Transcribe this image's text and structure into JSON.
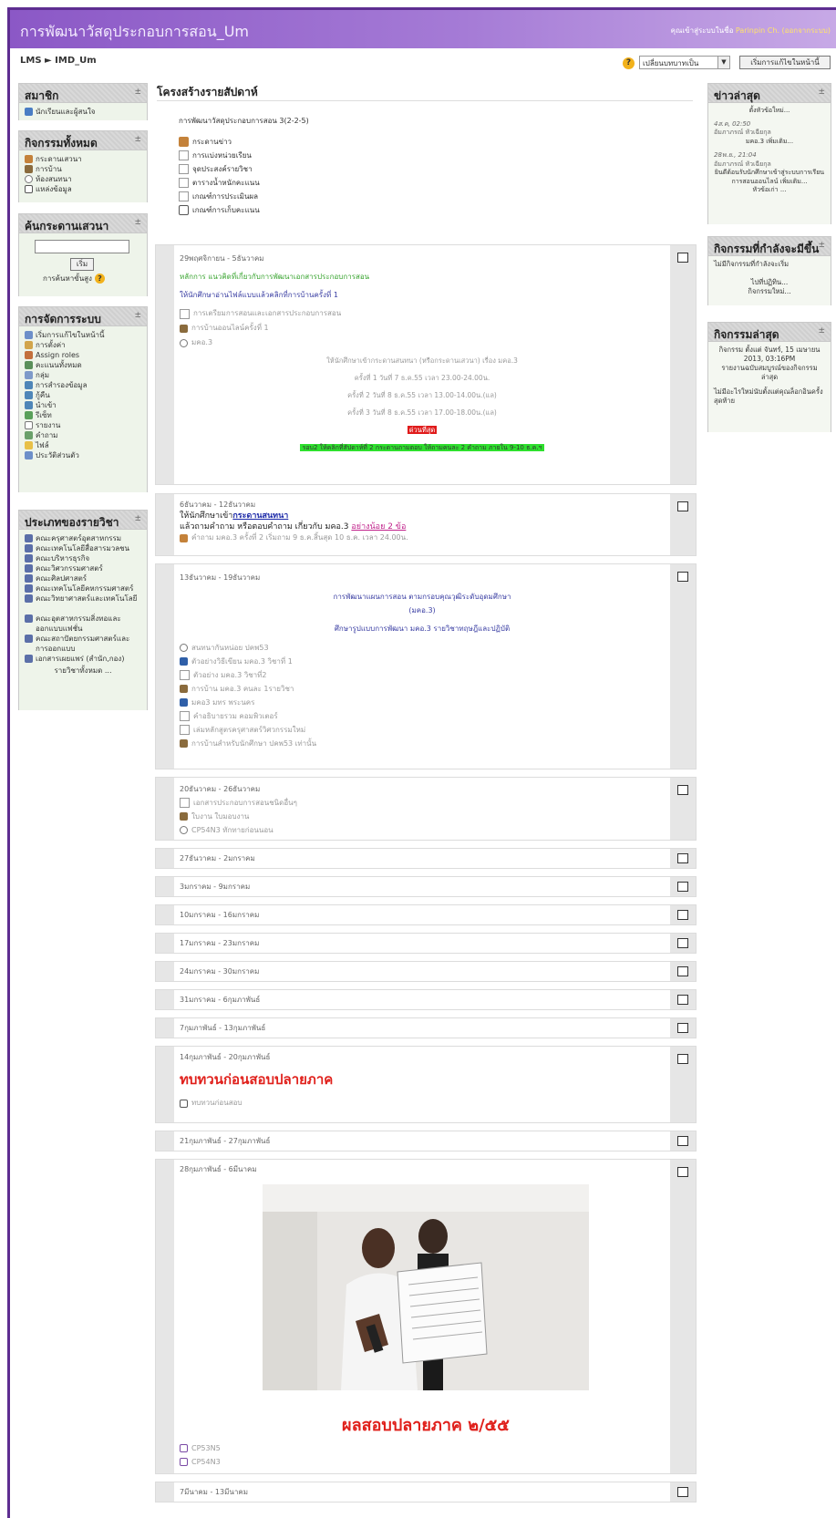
{
  "header": {
    "site_title": "การพัฒนาวัสดุประกอบการสอน_Um",
    "login_prefix": "คุณเข้าสู่ระบบในชื่อ",
    "user_name": "Parinpin Ch.",
    "logout_text": "(ออกจากระบบ)"
  },
  "nav": {
    "breadcrumb": "LMS ► IMD_Um",
    "role_select": "เปลี่ยนบทบาทเป็น",
    "edit_button": "เริ่มการแก้ไขในหน้านี้"
  },
  "left": {
    "members": {
      "title": "สมาชิก",
      "items": [
        "นักเรียนและผู้สนใจ"
      ]
    },
    "activities": {
      "title": "กิจกรรมทั้งหมด",
      "items": [
        "กระดานเสวนา",
        "การบ้าน",
        "ห้องสนทนา",
        "แหล่งข้อมูล"
      ]
    },
    "search": {
      "title": "ค้นกระดานเสวนา",
      "button": "เริ่ม",
      "advanced": "การค้นหาขั้นสูง"
    },
    "admin": {
      "title": "การจัดการระบบ",
      "items": [
        "เริ่มการแก้ไขในหน้านี้",
        "การตั้งค่า",
        "Assign roles",
        "คะแนนทั้งหมด",
        "กลุ่ม",
        "การสำรองข้อมูล",
        "กู้คืน",
        "นำเข้า",
        "รีเซ็ท",
        "รายงาน",
        "คำถาม",
        "ไฟล์",
        "ประวัติส่วนตัว"
      ]
    },
    "categories": {
      "title": "ประเภทของรายวิชา",
      "items": [
        "คณะครุศาสตร์อุตสาหกรรม",
        "คณะเทคโนโลยีสื่อสารมวลชน",
        "คณะบริหารธุรกิจ",
        "คณะวิศวกรรมศาสตร์",
        "คณะศิลปศาสตร์",
        "คณะเทคโนโลยีคหกรรมศาสตร์",
        "คณะวิทยาศาสตร์และเทคโนโลยี",
        "คณะอุตสาหกรรมสิ่งทอและออกแบบแฟชั่น",
        "คณะสถาปัตยกรรมศาสตร์และการออกแบบ",
        "เอกสารเผยแพร่ (สำนัก,กอง)"
      ],
      "all": "รายวิชาทั้งหมด ..."
    }
  },
  "right": {
    "news": {
      "title": "ข่าวล่าสุด",
      "add": "ตั้งหัวข้อใหม่...",
      "posts": [
        {
          "date": "4ส.ค, 02:50",
          "author": "อัมภาภรณ์ หัวเฉียกุล",
          "text": "มคอ.3 เพิ่มเติม..."
        },
        {
          "date": "28พ.ย., 21:04",
          "author": "อัมภาภรณ์ หัวเฉียกุล",
          "text": "ยินดีต้อนรับนักศึกษาเข้าสู่ระบบการเรียนการสอนออนไลน์ เพิ่มเติม...",
          "more": "หัวข้อเก่า ..."
        }
      ]
    },
    "upcoming": {
      "title": "กิจกรรมที่กำลังจะมีขึ้น",
      "none": "ไม่มีกิจกรรมที่กำลังจะเริ่ม",
      "calendar": "ไปที่ปฏิทิน...",
      "new": "กิจกรรมใหม่..."
    },
    "recent": {
      "title": "กิจกรรมล่าสุด",
      "since": "กิจกรรม ตั้งแต่ จันทร์, 15 เมษายน 2013, 03:16PM",
      "report": "รายงานฉบับสมบูรณ์ของกิจกรรมล่าสุด",
      "nothing": "ไม่มีอะไรใหม่นับตั้งแต่คุณล็อกอินครั้งสุดท้าย"
    }
  },
  "main": {
    "title": "โครงสร้างรายสัปดาห์",
    "course_name": "การพัฒนาวัสดุประกอบการสอน 3(2-2-5)",
    "intro_items": [
      "กระดานข่าว",
      "การแบ่งหน่วยเรียน",
      "จุดประสงค์รายวิชา",
      "ตารางน้ำหนักคะแนน",
      "เกณฑ์การประเมินผล",
      "เกณฑ์การเก็บคะแนน"
    ],
    "week1": {
      "label": "29พฤศจิกายน - 5ธันวาคม",
      "green": "หลักการ แนวคิดที่เกี่ยวกับการพัฒนาเอกสารประกอบการสอน",
      "blue": "ให้นักศึกษาอ่านไฟล์แบบแล้วคลิกที่การบ้านครั้งที่ 1",
      "items": [
        "การเตรียมการสอนและเอกสารประกอบการสอน",
        "การบ้านออนไลน์ครั้งที่ 1",
        "มคอ.3"
      ],
      "chat_intro": "ให้นักศึกษาเข้ากระดานสนทนา (หรือกระดานเสวนา) เรื่อง มคอ.3",
      "rounds": [
        "ครั้งที่ 1 วันที่ 7 ธ.ค.55 เวลา 23.00-24.00น.",
        "ครั้งที่ 2 วันที่ 8 ธ.ค.55 เวลา 13.00-14.00น.(แล)",
        "ครั้งที่ 3 วันที่ 8 ธ.ค.55 เวลา 17.00-18.00น.(แล)"
      ],
      "urgent": "ด่วนที่สุด",
      "highlight": "รอบ2 ให้คลิกที่สัปดาห์ที่ 2 กระดานถามตอบ ให้ถามคนละ 2 คำถาม ภายใน 9-10 ธ.ค.ฯ"
    },
    "week2": {
      "label": "6ธันวาคม - 12ธันวาคม",
      "line1_a": "ให้นักศึกษาเข้า",
      "line1_link": "กระดานสนทนา",
      "line2_a": "แล้วถามคำถาม หรือตอบคำถาม เกี่ยวกับ มคอ.3",
      "line2_link": "อย่างน้อย 2 ข้อ",
      "item": "คำถาม มคอ.3 ครั้งที่ 2 เริ่มถาม 9 ธ.ค.สิ้นสุด 10 ธ.ค. เวลา 24.00น."
    },
    "week3": {
      "label": "13ธันวาคม - 19ธันวาคม",
      "center1": "การพัฒนาแผนการสอน ตามกรอบคุณวุฒิระดับอุดมศึกษา",
      "center2": "(มคอ.3)",
      "center3": "ศึกษารูปแบบการพัฒนา มคอ.3 รายวิชาทฤษฎีและปฏิบัติ",
      "items": [
        "สนทนากันหน่อย ปคพ53",
        "ตัวอย่างวิธีเขียน มคอ.3 วิชาที่ 1",
        "ตัวอย่าง มคอ.3 วิชาที่2",
        "การบ้าน มคอ.3 คนละ 1รายวิชา",
        "มคอ3 มทร พระนคร",
        "คำอธิบายรวม คอมพิวเตอร์",
        "เล่มหลักสูตรครุศาสตร์วิศวกรรมใหม่",
        "การบ้านสำหรับนักศึกษา ปคพ53 เท่านั้น"
      ]
    },
    "week4": {
      "label": "20ธันวาคม - 26ธันวาคม",
      "items": [
        "เอกสารประกอบการสอนชนิดอื่นๆ",
        "ใบงาน ใบมอบงาน",
        "CP54N3 ทักทายก่อนนอน"
      ]
    },
    "empty_weeks": [
      "27ธันวาคม - 2มกราคม",
      "3มกราคม - 9มกราคม",
      "10มกราคม - 16มกราคม",
      "17มกราคม - 23มกราคม",
      "24มกราคม - 30มกราคม",
      "31มกราคม - 6กุมภาพันธ์",
      "7กุมภาพันธ์ - 13กุมภาพันธ์"
    ],
    "week12": {
      "label": "14กุมภาพันธ์ - 20กุมภาพันธ์",
      "heading": "ทบทวนก่อนสอบปลายภาค",
      "item": "ทบทวนก่อนสอบ"
    },
    "week13": {
      "label": "21กุมภาพันธ์ - 27กุมภาพันธ์"
    },
    "week14": {
      "label": "28กุมภาพันธ์ - 6มีนาคม",
      "heading": "ผลสอบปลายภาค ๒/๕๕",
      "items": [
        "CP53N5",
        "CP54N3"
      ]
    },
    "week15": {
      "label": "7มีนาคม - 13มีนาคม"
    }
  }
}
